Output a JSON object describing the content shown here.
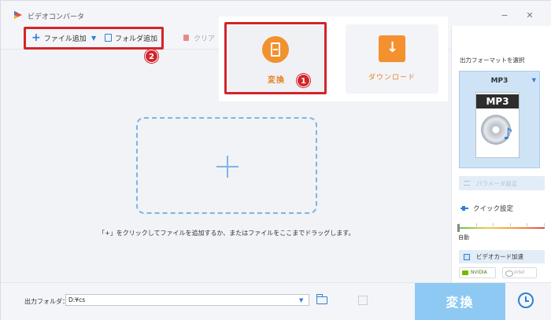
{
  "app": {
    "title": "ビデオコンバータ"
  },
  "toolbar": {
    "add_file_label": "ファイル追加",
    "add_folder_label": "フォルダ追加",
    "clear_label": "クリア"
  },
  "mode_popup": {
    "convert_label": "変換",
    "download_label": "ダウンロード"
  },
  "annotations": {
    "badge_1": "1",
    "badge_2": "2",
    "color": "#d2252b"
  },
  "drop_area": {
    "hint": "「+」をクリックしてファイルを追加するか、またはファイルをここまでドラッグします。"
  },
  "right_panel": {
    "title": "出力フォーマットを選択",
    "format_name": "MP3",
    "format_image_label": "MP3",
    "param_label": "パラメータ設定",
    "quick_label": "クイック設定",
    "slider_value_label": "自動",
    "gpu_label": "ビデオカード加速",
    "gpu_nvidia": "NVIDIA",
    "gpu_intel": "Intel"
  },
  "bottom": {
    "output_label": "出力フォルダ：",
    "output_path": "D:¥cs",
    "convert_button": "変換"
  },
  "colors": {
    "accent": "#2f7fd8",
    "orange": "#f2912e",
    "convert_button": "#8ec9f4"
  },
  "icons": [
    "app-logo-icon",
    "plus-icon",
    "chevron-down-icon",
    "folder-add-icon",
    "trash-icon",
    "film-icon",
    "download-icon",
    "music-disc-icon",
    "sliders-icon",
    "quick-setting-icon",
    "gpu-icon",
    "folder-open-icon",
    "preview-icon",
    "alarm-icon"
  ]
}
